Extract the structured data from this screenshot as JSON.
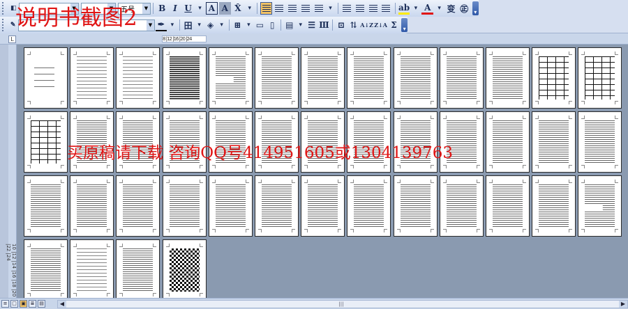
{
  "toolbar": {
    "font_size": "五号",
    "font_name": "",
    "bold": "B",
    "italic": "I",
    "underline": "U",
    "char_border": "A",
    "char_shading": "A",
    "insert_table": "田",
    "font_color": "A",
    "highlight": "ab",
    "phonetic": "变",
    "enclose": "㊣",
    "sort": "A↓Z",
    "sum": "Σ"
  },
  "ruler": {
    "tab_selector": "L",
    "marker_text": "8 |12 |16 |20 |24"
  },
  "vertical_ruler": {
    "numbers": "10 |12 |14 |16 |18 |20 |22 |24"
  },
  "pages": [
    "cover",
    "sparse",
    "sparse",
    "dense",
    "mixed",
    "text",
    "text",
    "text",
    "text",
    "text",
    "text",
    "table",
    "table",
    "table",
    "text",
    "text",
    "text",
    "text",
    "text",
    "text",
    "text",
    "text",
    "text",
    "text",
    "text",
    "text",
    "text",
    "text",
    "text",
    "text",
    "text",
    "text",
    "text",
    "text",
    "text",
    "text",
    "text",
    "text",
    "mixed",
    "text",
    "sparse",
    "text",
    "checker"
  ],
  "watermarks": {
    "title": "说明书截图2",
    "cta": "买原稿请下载 咨询QQ号414951605或1304139763"
  },
  "statusbar": {
    "view_normal": "≡",
    "view_web": "□",
    "view_print": "▣",
    "view_outline": "≣",
    "view_reading": "▤",
    "scroll_left": "◀",
    "scroll_right": "▶",
    "scroll_grip": "|||"
  },
  "colors": {
    "watermark_red": "#e01515",
    "doc_background": "#8a9ab0",
    "toolbar_blue": "#c9d7ee"
  }
}
